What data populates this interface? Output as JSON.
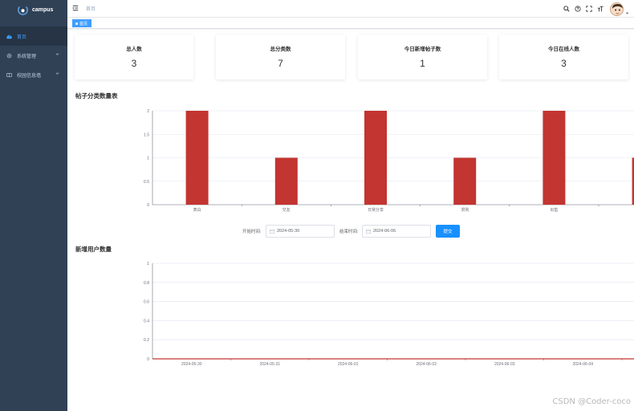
{
  "app": {
    "name": "campus"
  },
  "sidebar": {
    "items": [
      {
        "label": "首页",
        "icon": "dashboard-icon",
        "active": true
      },
      {
        "label": "系统管理",
        "icon": "gear-icon",
        "active": false
      },
      {
        "label": "校园信息墙",
        "icon": "book-icon",
        "active": false
      }
    ]
  },
  "header": {
    "breadcrumb": "首页"
  },
  "tags": [
    {
      "label": "首页"
    }
  ],
  "stats": [
    {
      "label": "总人数",
      "value": "3"
    },
    {
      "label": "总分类数",
      "value": "7"
    },
    {
      "label": "今日新增帖子数",
      "value": "1"
    },
    {
      "label": "今日在线人数",
      "value": "3"
    }
  ],
  "sections": {
    "category_chart_title": "帖子分类数量表",
    "user_chart_title": "新增用户数量"
  },
  "filter": {
    "start_label": "开始时间:",
    "start_value": "2024-05-30",
    "end_label": "结束时间:",
    "end_value": "2024-06-06",
    "submit_label": "提交"
  },
  "watermark": "CSDN @Coder-coco",
  "colors": {
    "sidebar_bg": "#304156",
    "accent": "#409eff",
    "bar": "#c23531",
    "button": "#1890ff"
  },
  "chart_data": [
    {
      "type": "bar",
      "title": "帖子分类数量表",
      "categories": [
        "表白",
        "交友",
        "日常分享",
        "求购",
        "出售"
      ],
      "values": [
        2,
        1,
        2,
        1,
        2
      ],
      "ylim": [
        0,
        2
      ],
      "yticks": [
        "0",
        "0.5",
        "1",
        "1.5",
        "2"
      ],
      "grid": true
    },
    {
      "type": "line",
      "title": "新增用户数量",
      "x": [
        "2024-05-30",
        "2024-05-31",
        "2024-06-01",
        "2024-06-02",
        "2024-06-03",
        "2024-06-04"
      ],
      "values": [
        0,
        0,
        0,
        0,
        0,
        0
      ],
      "ylim": [
        0,
        1
      ],
      "yticks": [
        "0",
        "0.2",
        "0.4",
        "0.6",
        "0.8",
        "1"
      ],
      "grid": true
    }
  ]
}
